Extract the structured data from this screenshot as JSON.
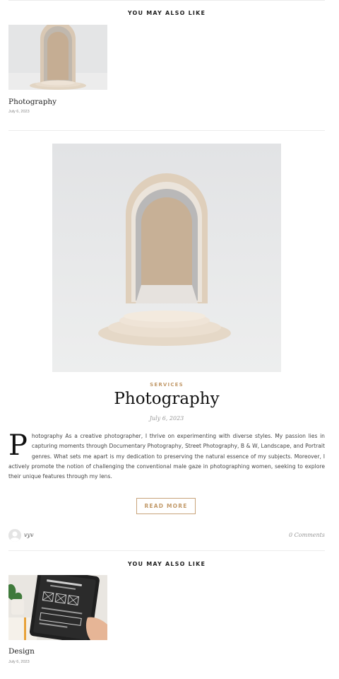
{
  "related_top": {
    "heading": "YOU MAY ALSO LIKE",
    "item": {
      "title": "Photography",
      "date": "July 6, 2023",
      "image": "arch-podium-image"
    }
  },
  "post": {
    "image": "arch-podium-image",
    "category": "SERVICES",
    "title": "Photography",
    "date": "July 6, 2023",
    "dropcap": "P",
    "excerpt": "hotography As a creative photographer, I thrive on experimenting with diverse styles. My passion lies in capturing moments through Documentary Photography, Street Photography, B & W, Landscape, and Portrait genres. What sets me apart is my dedication to preserving the natural essence of my subjects. Moreover, I actively promote the notion of challenging the conventional male gaze in photographing women, seeking to explore their unique features through my lens.",
    "read_more": "READ MORE",
    "author": "vyv",
    "comments": "0 Comments"
  },
  "related_bottom": {
    "heading": "YOU MAY ALSO LIKE",
    "item": {
      "title": "Design",
      "date": "July 6, 2023",
      "image": "tablet-wireframe-image"
    }
  },
  "colors": {
    "accent": "#c29a6a",
    "divider": "#ececec",
    "text": "#444444"
  }
}
